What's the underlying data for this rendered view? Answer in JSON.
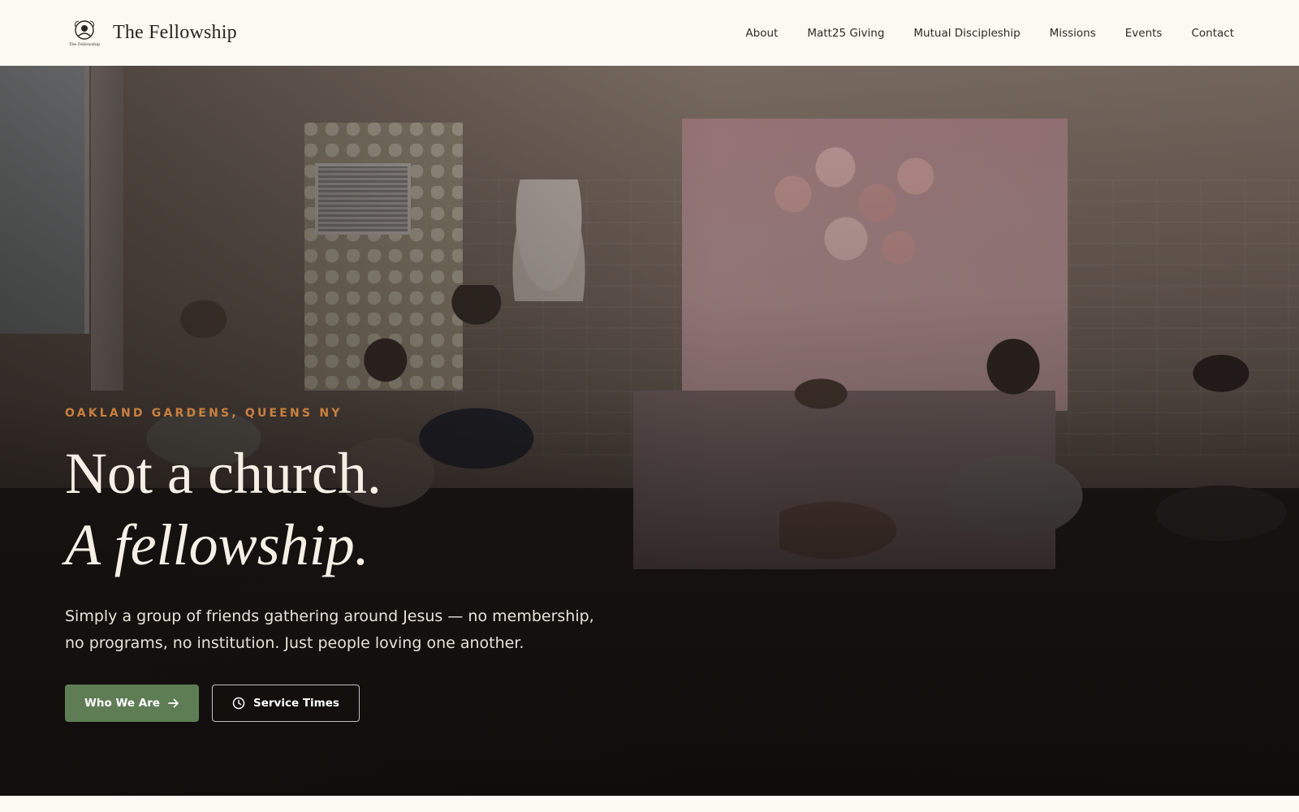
{
  "header": {
    "brand_name": "The Fellowship",
    "logo_caption": "The Fellowship",
    "logo_icon": "fellowship-logo-icon",
    "nav": [
      {
        "label": "About"
      },
      {
        "label": "Matt25 Giving"
      },
      {
        "label": "Mutual Discipleship"
      },
      {
        "label": "Missions"
      },
      {
        "label": "Events"
      },
      {
        "label": "Contact"
      }
    ]
  },
  "hero": {
    "eyebrow": "OAKLAND GARDENS, QUEENS NY",
    "headline_line1": "Not a church.",
    "headline_line2": "A fellowship.",
    "subtitle": "Simply a group of friends gathering around Jesus — no membership, no programs, no institution. Just people loving one another.",
    "primary_button": {
      "label": "Who We Are",
      "icon": "arrow-right-icon"
    },
    "secondary_button": {
      "label": "Service Times",
      "icon": "clock-icon"
    }
  },
  "colors": {
    "background": "#fcf8f2",
    "accent_orange": "#c9803f",
    "button_green": "#5e7d55",
    "headline_text": "#f6efe6"
  }
}
